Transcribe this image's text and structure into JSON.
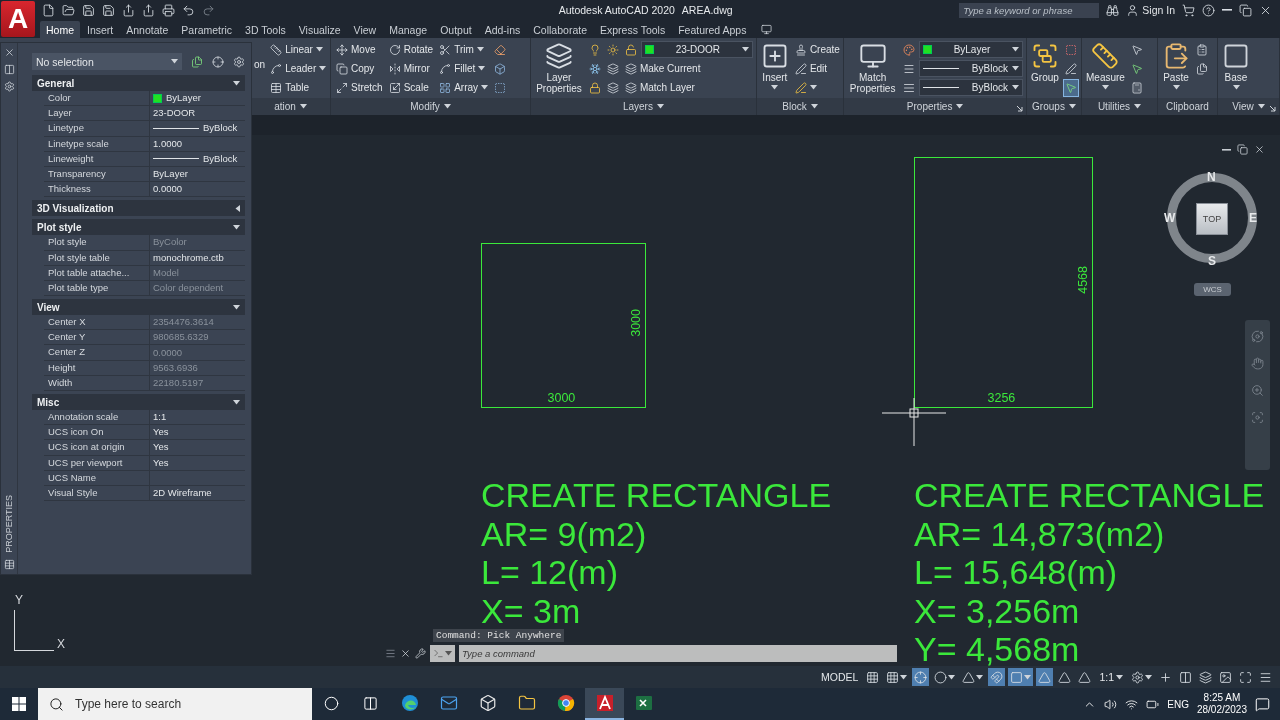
{
  "app": {
    "logo_letter": "A",
    "title": "Autodesk AutoCAD 2020",
    "file_name": "AREA.dwg",
    "search_placeholder": "Type a keyword or phrase",
    "sign_in": "Sign In"
  },
  "tabs": [
    {
      "label": "Home",
      "selected": true
    },
    {
      "label": "Insert",
      "selected": false
    },
    {
      "label": "Annotate",
      "selected": false
    },
    {
      "label": "Parametric",
      "selected": false
    },
    {
      "label": "3D Tools",
      "selected": false
    },
    {
      "label": "Visualize",
      "selected": false
    },
    {
      "label": "View",
      "selected": false
    },
    {
      "label": "Manage",
      "selected": false
    },
    {
      "label": "Output",
      "selected": false
    },
    {
      "label": "Add-ins",
      "selected": false
    },
    {
      "label": "Collaborate",
      "selected": false
    },
    {
      "label": "Express Tools",
      "selected": false
    },
    {
      "label": "Featured Apps",
      "selected": false
    }
  ],
  "ribbon": [
    {
      "title": "ation",
      "dropdown": true,
      "launcher": false,
      "items": [
        {
          "kind": "stub",
          "label": "on"
        },
        {
          "kind": "grid",
          "rows": [
            [
              {
                "kind": "button",
                "label": "Linear",
                "dropdown": true
              }
            ],
            [
              {
                "kind": "button",
                "label": "Leader",
                "dropdown": true
              }
            ],
            [
              {
                "kind": "button",
                "label": "Table",
                "dropdown": false
              }
            ]
          ]
        }
      ]
    },
    {
      "title": "Modify",
      "dropdown": true,
      "launcher": false,
      "items": [
        {
          "kind": "grid",
          "rows": [
            [
              {
                "kind": "button",
                "label": "Move",
                "dropdown": false
              },
              {
                "kind": "button",
                "label": "Rotate",
                "dropdown": false
              },
              {
                "kind": "button",
                "label": "Trim",
                "dropdown": true
              },
              {
                "kind": "button",
                "dropdown": false
              }
            ],
            [
              {
                "kind": "button",
                "label": "Copy",
                "dropdown": false
              },
              {
                "kind": "button",
                "label": "Mirror",
                "dropdown": false
              },
              {
                "kind": "button",
                "label": "Fillet",
                "dropdown": true
              },
              {
                "kind": "button",
                "dropdown": false
              }
            ],
            [
              {
                "kind": "button",
                "label": "Stretch",
                "dropdown": false
              },
              {
                "kind": "button",
                "label": "Scale",
                "dropdown": false
              },
              {
                "kind": "button",
                "label": "Array",
                "dropdown": true
              },
              {
                "kind": "button",
                "dropdown": false
              }
            ]
          ]
        }
      ]
    },
    {
      "title": "Layers",
      "dropdown": true,
      "launcher": false,
      "items": [
        {
          "kind": "large",
          "label": "Layer Properties",
          "dropdown": false
        },
        {
          "kind": "grid",
          "rows": [
            [
              {
                "kind": "button",
                "dropdown": false
              },
              {
                "kind": "button",
                "dropdown": false
              },
              {
                "kind": "button",
                "dropdown": false
              },
              {
                "kind": "swatch_select",
                "value": "23-DOOR"
              }
            ],
            [
              {
                "kind": "button",
                "dropdown": false
              },
              {
                "kind": "button",
                "dropdown": false
              },
              {
                "kind": "button",
                "label": "Make Current",
                "dropdown": false
              }
            ],
            [
              {
                "kind": "button",
                "dropdown": false
              },
              {
                "kind": "button",
                "dropdown": false
              },
              {
                "kind": "button",
                "label": "Match Layer",
                "dropdown": false
              }
            ]
          ]
        }
      ]
    },
    {
      "title": "Block",
      "dropdown": true,
      "launcher": false,
      "items": [
        {
          "kind": "large",
          "label": "Insert",
          "dropdown": true
        },
        {
          "kind": "grid",
          "rows": [
            [
              {
                "kind": "button",
                "label": "Create",
                "dropdown": false
              }
            ],
            [
              {
                "kind": "button",
                "label": "Edit",
                "dropdown": false
              }
            ],
            [
              {
                "kind": "button",
                "dropdown": true
              }
            ]
          ]
        }
      ]
    },
    {
      "title": "Properties",
      "dropdown": true,
      "launcher": true,
      "items": [
        {
          "kind": "large",
          "label": "Match Properties",
          "dropdown": false
        },
        {
          "kind": "grid",
          "rows": [
            [
              {
                "kind": "button",
                "dropdown": false
              },
              {
                "kind": "swatch_select",
                "value": "ByLayer"
              }
            ],
            [
              {
                "kind": "button",
                "dropdown": false
              },
              {
                "kind": "line_select",
                "value": "ByBlock"
              }
            ],
            [
              {
                "kind": "button",
                "dropdown": false
              },
              {
                "kind": "line_select",
                "value": "ByBlock"
              }
            ]
          ]
        }
      ]
    },
    {
      "title": "Groups",
      "dropdown": true,
      "launcher": false,
      "items": [
        {
          "kind": "large",
          "label": "Group",
          "dropdown": false
        },
        {
          "kind": "grid",
          "rows": [
            [
              {
                "kind": "button",
                "dropdown": false,
                "on": false
              }
            ],
            [
              {
                "kind": "button",
                "dropdown": false,
                "on": false
              }
            ],
            [
              {
                "kind": "button",
                "dropdown": false,
                "on": true
              }
            ]
          ]
        }
      ]
    },
    {
      "title": "Utilities",
      "dropdown": true,
      "launcher": false,
      "items": [
        {
          "kind": "large",
          "label": "Measure",
          "dropdown": true
        },
        {
          "kind": "grid",
          "rows": [
            [
              {
                "kind": "button",
                "dropdown": false
              }
            ],
            [
              {
                "kind": "button",
                "dropdown": false
              }
            ],
            [
              {
                "kind": "button",
                "dropdown": false
              }
            ]
          ]
        }
      ]
    },
    {
      "title": "Clipboard",
      "dropdown": false,
      "launcher": false,
      "items": [
        {
          "kind": "large",
          "label": "Paste",
          "dropdown": true
        },
        {
          "kind": "grid",
          "rows": [
            [
              {
                "kind": "button",
                "dropdown": false
              }
            ],
            [
              {
                "kind": "button",
                "dropdown": false
              }
            ]
          ]
        }
      ]
    },
    {
      "title": "View",
      "dropdown": true,
      "launcher": true,
      "items": [
        {
          "kind": "large",
          "label": "Base",
          "dropdown": true
        }
      ]
    }
  ],
  "properties_palette": {
    "title": "PROPERTIES",
    "selection": "No selection",
    "sections": [
      {
        "title": "General",
        "expanded": true,
        "rows": [
          {
            "label": "Color",
            "value": "ByLayer",
            "kind": "swatch",
            "disabled": false
          },
          {
            "label": "Layer",
            "value": "23-DOOR",
            "kind": "text",
            "disabled": false
          },
          {
            "label": "Linetype",
            "value": "ByBlock",
            "kind": "line",
            "disabled": false
          },
          {
            "label": "Linetype scale",
            "value": "1.0000",
            "kind": "text",
            "disabled": false
          },
          {
            "label": "Lineweight",
            "value": "ByBlock",
            "kind": "line",
            "disabled": false
          },
          {
            "label": "Transparency",
            "value": "ByLayer",
            "kind": "text",
            "disabled": false
          },
          {
            "label": "Thickness",
            "value": "0.0000",
            "kind": "text",
            "disabled": false
          }
        ]
      },
      {
        "title": "3D Visualization",
        "expanded": false
      },
      {
        "title": "Plot style",
        "expanded": true,
        "rows": [
          {
            "label": "Plot style",
            "value": "ByColor",
            "kind": "text",
            "disabled": true
          },
          {
            "label": "Plot style table",
            "value": "monochrome.ctb",
            "kind": "text",
            "disabled": false
          },
          {
            "label": "Plot table attache...",
            "value": "Model",
            "kind": "text",
            "disabled": true
          },
          {
            "label": "Plot table type",
            "value": "Color dependent",
            "kind": "text",
            "disabled": true
          }
        ]
      },
      {
        "title": "View",
        "expanded": true,
        "rows": [
          {
            "label": "Center X",
            "value": "2354476.3614",
            "kind": "text",
            "disabled": true
          },
          {
            "label": "Center Y",
            "value": "980685.6329",
            "kind": "text",
            "disabled": true
          },
          {
            "label": "Center Z",
            "value": "0.0000",
            "kind": "text",
            "disabled": true
          },
          {
            "label": "Height",
            "value": "9563.6936",
            "kind": "text",
            "disabled": true
          },
          {
            "label": "Width",
            "value": "22180.5197",
            "kind": "text",
            "disabled": true
          }
        ]
      },
      {
        "title": "Misc",
        "expanded": true,
        "rows": [
          {
            "label": "Annotation scale",
            "value": "1:1",
            "kind": "text",
            "disabled": false
          },
          {
            "label": "UCS icon On",
            "value": "Yes",
            "kind": "text",
            "disabled": false
          },
          {
            "label": "UCS icon at origin",
            "value": "Yes",
            "kind": "text",
            "disabled": false
          },
          {
            "label": "UCS per viewport",
            "value": "Yes",
            "kind": "text",
            "disabled": false
          },
          {
            "label": "UCS Name",
            "kind": "text",
            "disabled": false
          },
          {
            "label": "Visual Style",
            "value": "2D Wireframe",
            "kind": "text",
            "disabled": false
          }
        ]
      }
    ]
  },
  "drawing": {
    "rectangles": [
      {
        "width_label": "3000",
        "height_label": "3000",
        "notes": [
          "CREATE RECTANGLE",
          "AR= 9(m2)",
          "L= 12(m)",
          "X= 3m"
        ]
      },
      {
        "width_label": "3256",
        "height_label": "4568",
        "notes": [
          "CREATE RECTANGLE",
          "AR= 14,873(m2)",
          "L= 15,648(m)",
          "X= 3,256m",
          "Y= 4,568m"
        ]
      }
    ],
    "viewcube": {
      "north": "N",
      "east": "E",
      "south": "S",
      "west": "W",
      "face": "TOP",
      "ucs": "WCS"
    },
    "ucs_icon": {
      "y": "Y",
      "x": "X"
    }
  },
  "command_line": {
    "history": "Command: Pick Anywhere",
    "placeholder": "Type a command"
  },
  "status_bar": [
    {
      "kind": "text",
      "label": "MODEL",
      "dropdown": false
    },
    {
      "kind": "toggle",
      "on": false,
      "dropdown": false
    },
    {
      "kind": "toggle",
      "on": false,
      "dropdown": true
    },
    {
      "kind": "toggle",
      "on": true,
      "dropdown": false
    },
    {
      "kind": "toggle",
      "on": false,
      "dropdown": true
    },
    {
      "kind": "toggle",
      "on": false,
      "dropdown": true
    },
    {
      "kind": "toggle",
      "on": true,
      "dropdown": false
    },
    {
      "kind": "toggle",
      "on": true,
      "dropdown": true
    },
    {
      "kind": "toggle",
      "on": true,
      "dropdown": false
    },
    {
      "kind": "toggle",
      "on": false,
      "dropdown": false
    },
    {
      "kind": "toggle",
      "on": false,
      "dropdown": false
    },
    {
      "kind": "text",
      "label": "1:1",
      "dropdown": true
    },
    {
      "kind": "toggle",
      "on": false,
      "dropdown": true
    },
    {
      "kind": "toggle",
      "on": false,
      "dropdown": false
    },
    {
      "kind": "toggle",
      "on": false,
      "dropdown": false
    },
    {
      "kind": "toggle",
      "on": false,
      "dropdown": false
    },
    {
      "kind": "toggle",
      "on": false,
      "dropdown": false
    },
    {
      "kind": "toggle",
      "on": false,
      "dropdown": false
    },
    {
      "kind": "toggle",
      "on": false,
      "dropdown": false
    }
  ],
  "taskbar": {
    "search_placeholder": "Type here to search",
    "apps": [
      {
        "selected": false
      },
      {
        "selected": false
      },
      {
        "selected": false
      },
      {
        "selected": false
      },
      {
        "selected": false
      },
      {
        "selected": true
      },
      {
        "selected": false
      }
    ],
    "language": "ENG",
    "time": "8:25 AM",
    "date": "28/02/2023"
  }
}
